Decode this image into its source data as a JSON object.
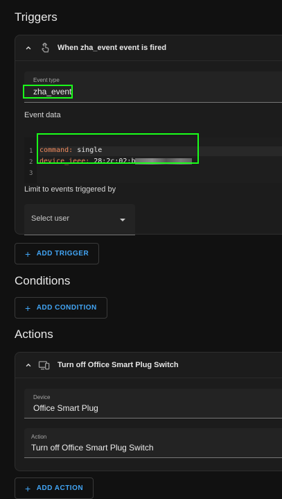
{
  "triggers": {
    "heading": "Triggers",
    "card": {
      "title": "When zha_event event is fired",
      "event_type_label": "Event type",
      "event_type_value": "zha_event",
      "event_data_label": "Event data",
      "code_lines": [
        {
          "num": "1",
          "key": "command:",
          "value": " single"
        },
        {
          "num": "2",
          "key": "device_ieee:",
          "value": " 28:2c:02:b"
        },
        {
          "num": "3",
          "key": "",
          "value": ""
        }
      ],
      "limit_label": "Limit to events triggered by",
      "select_placeholder": "Select user"
    },
    "add_button": "ADD TRIGGER"
  },
  "conditions": {
    "heading": "Conditions",
    "add_button": "ADD CONDITION"
  },
  "actions": {
    "heading": "Actions",
    "card": {
      "title": "Turn off Office Smart Plug Switch",
      "device_label": "Device",
      "device_value": "Office Smart Plug",
      "action_label": "Action",
      "action_value": "Turn off Office Smart Plug Switch"
    },
    "add_button": "ADD ACTION"
  },
  "colors": {
    "accent": "#42a5f5",
    "highlight": "#1aff1a",
    "yaml_key": "#f08a5d"
  },
  "icons": [
    "chevron-up-icon",
    "gesture-tap-icon",
    "devices-icon",
    "plus-icon",
    "menu-down-icon"
  ]
}
